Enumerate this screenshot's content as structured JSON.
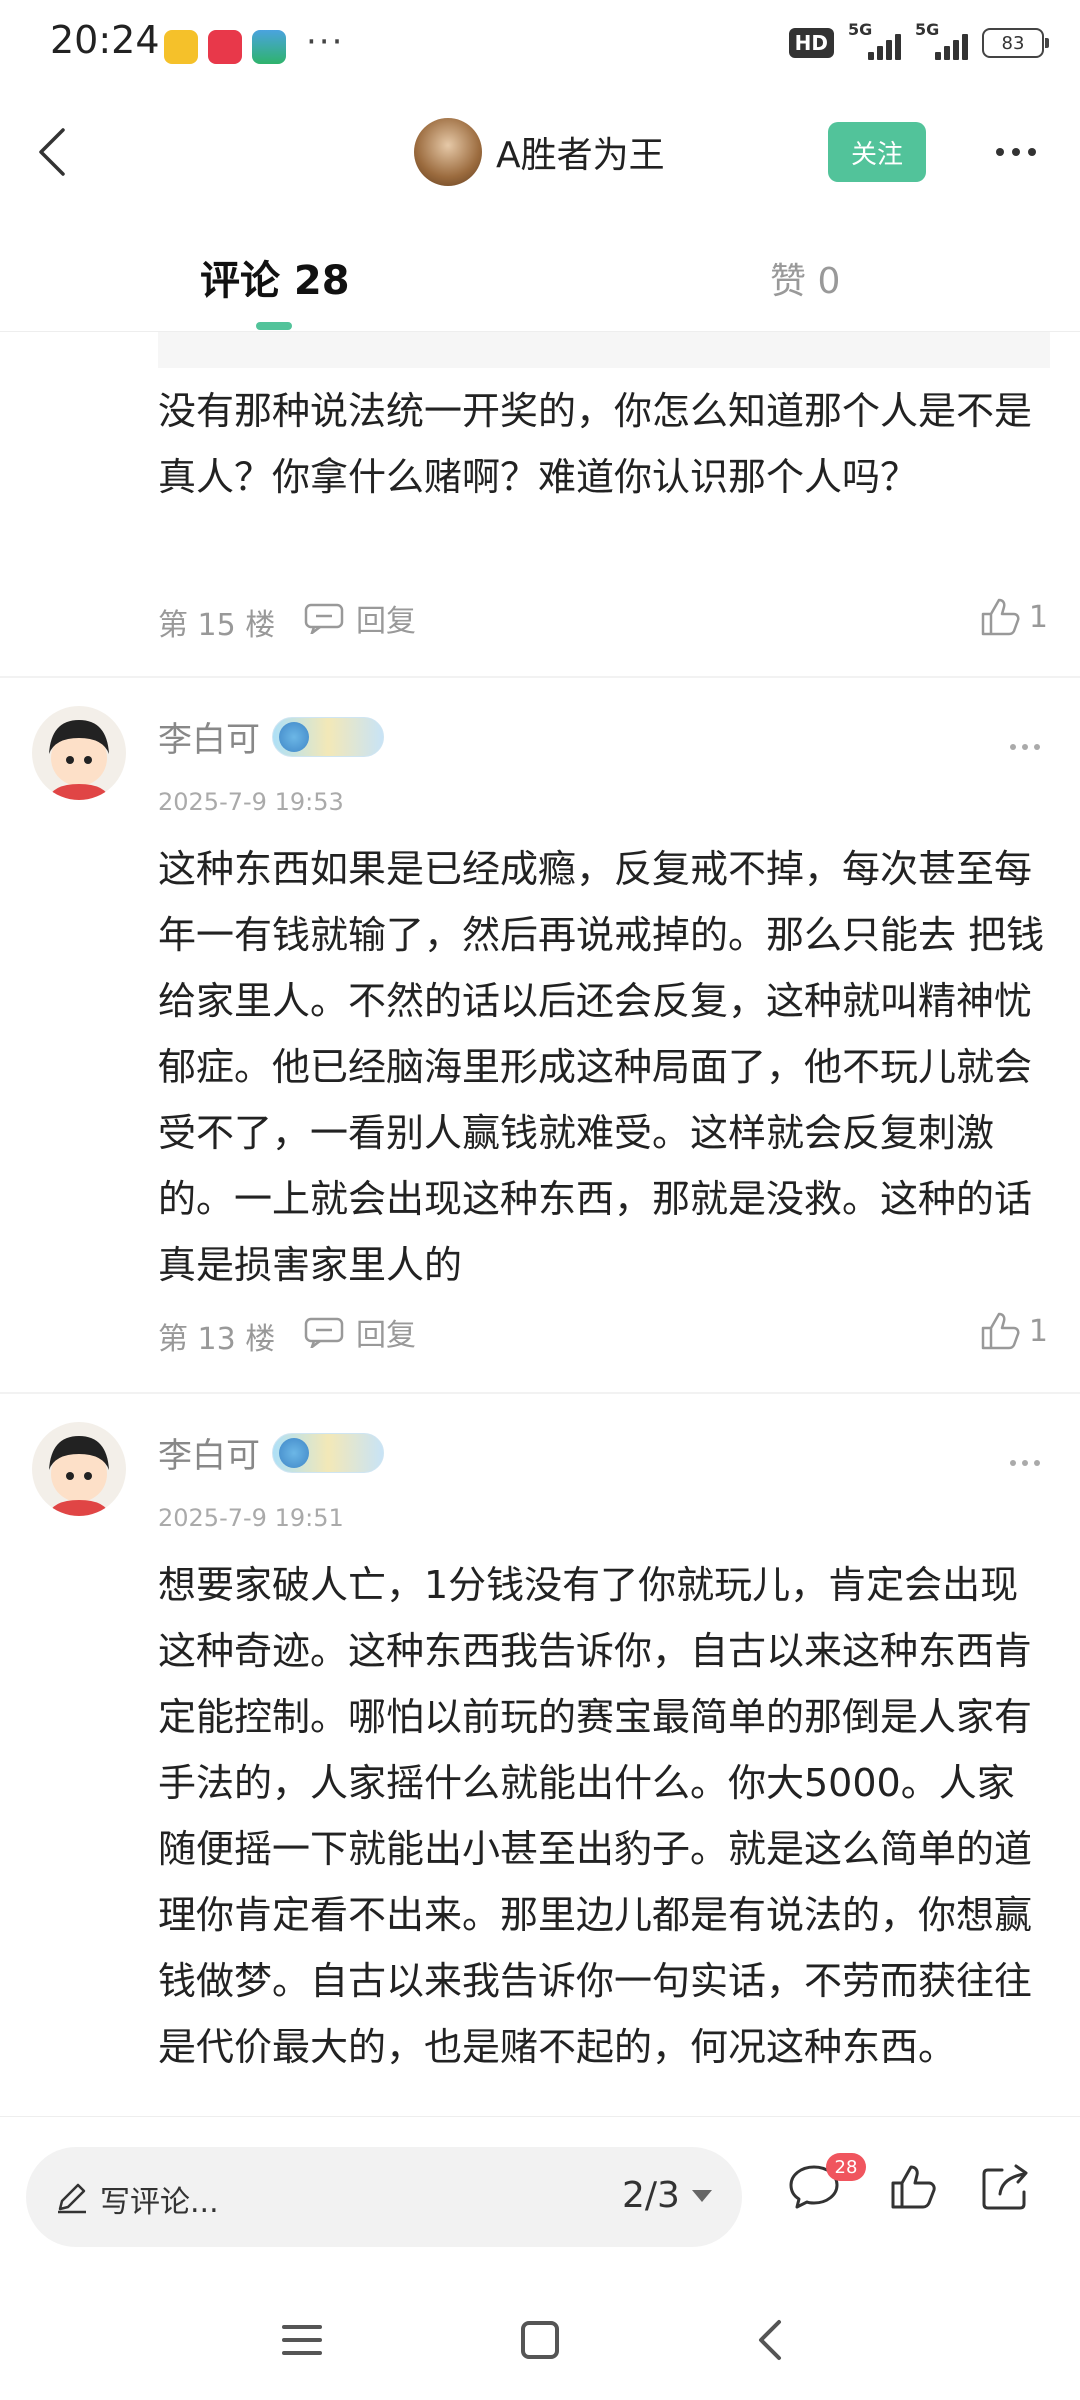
{
  "status_bar": {
    "time": "20:24",
    "more": "···",
    "hd": "HD",
    "network_1": "5G",
    "network_2": "5G",
    "battery": "83"
  },
  "header": {
    "author_name": "A胜者为王",
    "follow_label": "关注"
  },
  "tabs": {
    "comments_label": "评论 28",
    "likes_label": "赞 0"
  },
  "comments": [
    {
      "text": "没有那种说法统一开奖的，你怎么知道那个人是不是真人？你拿什么赌啊？难道你认识那个人吗？",
      "floor": "第 15 楼",
      "reply_label": "回复",
      "likes": "1"
    },
    {
      "author": "李白可",
      "time": "2025-7-9 19:53",
      "text": "这种东西如果是已经成瘾，反复戒不掉，每次甚至每年一有钱就输了，然后再说戒掉的。那么只能去 把钱给家里人。不然的话以后还会反复，这种就叫精神忧郁症。他已经脑海里形成这种局面了，他不玩儿就会受不了，一看别人赢钱就难受。这样就会反复刺激的。一上就会出现这种东西，那就是没救。这种的话真是损害家里人的",
      "floor": "第 13 楼",
      "reply_label": "回复",
      "likes": "1"
    },
    {
      "author": "李白可",
      "time": "2025-7-9 19:51",
      "text": "想要家破人亡，1分钱没有了你就玩儿，肯定会出现这种奇迹。这种东西我告诉你，自古以来这种东西肯定能控制。哪怕以前玩的赛宝最简单的那倒是人家有手法的，人家摇什么就能出什么。你大5000。人家随便摇一下就能出小甚至出豹子。就是这么简单的道理你肯定看不出来。那里边儿都是有说法的，你想赢钱做梦。自古以来我告诉你一句实话，不劳而获往往是代价最大的，也是赌不起的，何况这种东西。"
    }
  ],
  "bottom_bar": {
    "write_placeholder": "写评论...",
    "page_indicator": "2/3",
    "comment_count_badge": "28"
  },
  "colors": {
    "accent": "#52c39a",
    "badge": "#f0555e"
  }
}
